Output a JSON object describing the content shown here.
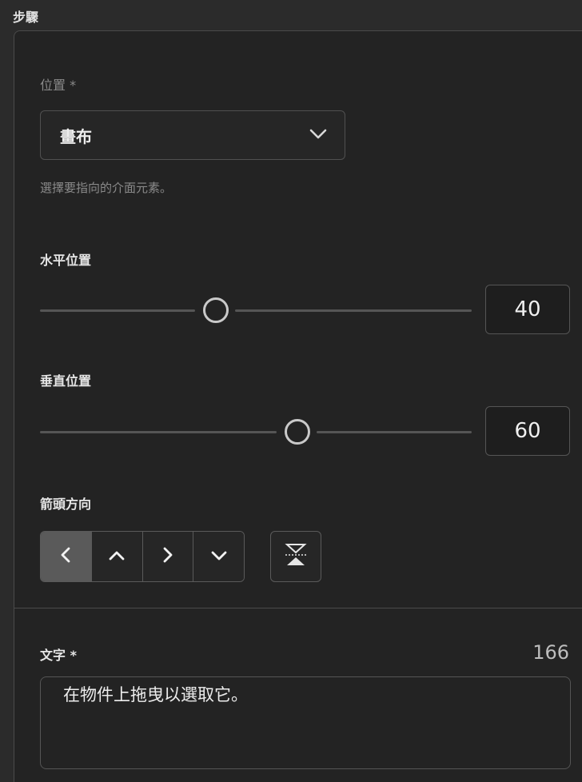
{
  "section": {
    "title": "步驟"
  },
  "location": {
    "label": "位置 *",
    "selected": "畫布",
    "help": "選擇要指向的介面元素。"
  },
  "horizontal": {
    "label": "水平位置",
    "value": "40"
  },
  "vertical": {
    "label": "垂直位置",
    "value": "60"
  },
  "arrow": {
    "label": "箭頭方向",
    "selected": "left",
    "options": [
      "left",
      "up",
      "right",
      "down"
    ]
  },
  "text": {
    "label": "文字 *",
    "remaining": "166",
    "value": "在物件上拖曳以選取它。"
  }
}
